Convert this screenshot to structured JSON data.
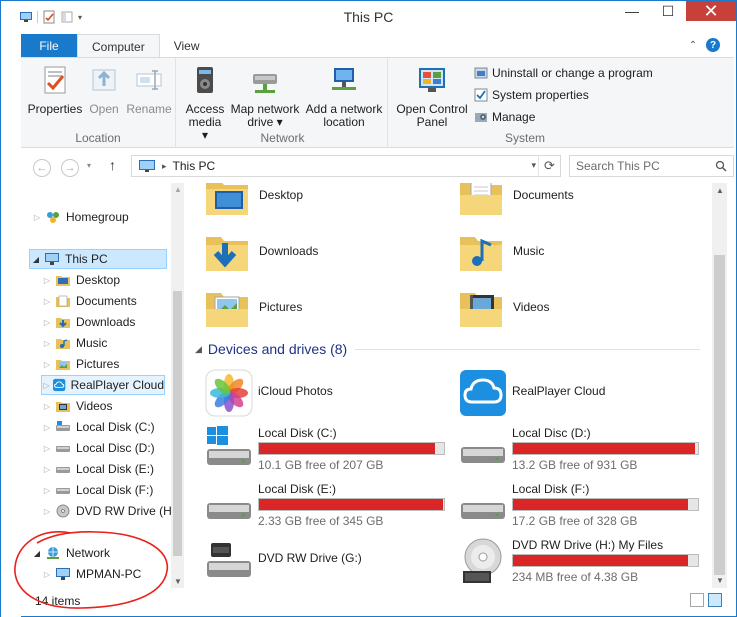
{
  "window": {
    "title": "This PC",
    "minimize_icon": "minimize-icon",
    "maximize_icon": "maximize-icon",
    "close_icon": "close-icon",
    "close_color": "#c7413a",
    "accent": "#1979ca"
  },
  "tabs": [
    {
      "label": "File"
    },
    {
      "label": "Computer"
    },
    {
      "label": "View"
    }
  ],
  "ribbon": {
    "location": {
      "caption": "Location",
      "buttons": [
        {
          "label": "Properties",
          "icon": "properties-icon",
          "enabled": true
        },
        {
          "label": "Open",
          "icon": "open-icon",
          "enabled": false
        },
        {
          "label": "Rename",
          "icon": "rename-icon",
          "enabled": false
        }
      ]
    },
    "network": {
      "caption": "Network",
      "buttons": [
        {
          "label1": "Access",
          "label2": "media ▾",
          "icon": "access-media-icon"
        },
        {
          "label1": "Map network",
          "label2": "drive ▾",
          "icon": "map-network-drive-icon"
        },
        {
          "label1": "Add a network",
          "label2": "location",
          "icon": "add-network-location-icon"
        }
      ]
    },
    "system": {
      "caption": "System",
      "open_control_panel": {
        "label1": "Open Control",
        "label2": "Panel",
        "icon": "control-panel-icon"
      },
      "small": [
        {
          "label": "Uninstall or change a program",
          "icon": "uninstall-icon"
        },
        {
          "label": "System properties",
          "icon": "system-properties-icon"
        },
        {
          "label": "Manage",
          "icon": "manage-icon"
        }
      ]
    }
  },
  "address": {
    "path": "This PC",
    "search_placeholder": "Search This PC"
  },
  "nav": {
    "items": [
      {
        "label": "Homegroup",
        "icon": "homegroup-icon",
        "level": 0,
        "expanded": false
      },
      {
        "label": "This PC",
        "icon": "computer-icon",
        "level": 0,
        "expanded": true,
        "selected": true
      },
      {
        "label": "Desktop",
        "icon": "desktop-folder-icon",
        "level": 1
      },
      {
        "label": "Documents",
        "icon": "documents-folder-icon",
        "level": 1
      },
      {
        "label": "Downloads",
        "icon": "downloads-folder-icon",
        "level": 1
      },
      {
        "label": "Music",
        "icon": "music-folder-icon",
        "level": 1
      },
      {
        "label": "Pictures",
        "icon": "pictures-folder-icon",
        "level": 1
      },
      {
        "label": "RealPlayer Cloud",
        "icon": "realplayer-cloud-icon",
        "level": 1,
        "highlight": true
      },
      {
        "label": "Videos",
        "icon": "videos-folder-icon",
        "level": 1
      },
      {
        "label": "Local Disk (C:)",
        "icon": "hard-disk-icon",
        "level": 1
      },
      {
        "label": "Local Disc (D:)",
        "icon": "hard-disk-icon",
        "level": 1
      },
      {
        "label": "Local Disk (E:)",
        "icon": "hard-disk-icon",
        "level": 1
      },
      {
        "label": "Local Disk (F:)",
        "icon": "hard-disk-icon",
        "level": 1
      },
      {
        "label": "DVD RW Drive (H:",
        "icon": "dvd-drive-icon",
        "level": 1
      },
      {
        "label": "Network",
        "icon": "network-icon",
        "level": 0,
        "expanded": true
      },
      {
        "label": "MPMAN-PC",
        "icon": "computer-icon",
        "level": 1
      }
    ]
  },
  "folders": [
    {
      "label": "Desktop",
      "icon": "desktop-folder-icon"
    },
    {
      "label": "Documents",
      "icon": "documents-folder-icon"
    },
    {
      "label": "Downloads",
      "icon": "downloads-folder-icon"
    },
    {
      "label": "Music",
      "icon": "music-folder-icon"
    },
    {
      "label": "Pictures",
      "icon": "pictures-folder-icon"
    },
    {
      "label": "Videos",
      "icon": "videos-folder-icon"
    }
  ],
  "devices": {
    "title": "Devices and drives (8)",
    "items": [
      {
        "label": "iCloud Photos",
        "icon": "icloud-photos-icon"
      },
      {
        "label": "RealPlayer Cloud",
        "icon": "realplayer-cloud-icon"
      },
      {
        "label": "Local Disk (C:)",
        "free": "10.1 GB free of 207 GB",
        "used_fraction": 0.951,
        "icon": "windows-disk-icon"
      },
      {
        "label": "Local Disc (D:)",
        "free": "13.2 GB free of 931 GB",
        "used_fraction": 0.986,
        "icon": "hard-disk-icon"
      },
      {
        "label": "Local Disk (E:)",
        "free": "2.33 GB free of 345 GB",
        "used_fraction": 0.993,
        "icon": "hard-disk-icon"
      },
      {
        "label": "Local Disk (F:)",
        "free": "17.2 GB free of 328 GB",
        "used_fraction": 0.948,
        "icon": "hard-disk-icon"
      },
      {
        "label": "DVD RW Drive (G:)",
        "icon": "dvd-drive-icon"
      },
      {
        "label": "DVD RW Drive (H:) My Files",
        "free": "234 MB free of 4.38 GB",
        "used_fraction": 0.948,
        "icon": "dvd-r-disc-icon"
      }
    ],
    "bar_color": "#da2626"
  },
  "status": {
    "items": "14 items"
  },
  "annotation_color": "#e8211c"
}
